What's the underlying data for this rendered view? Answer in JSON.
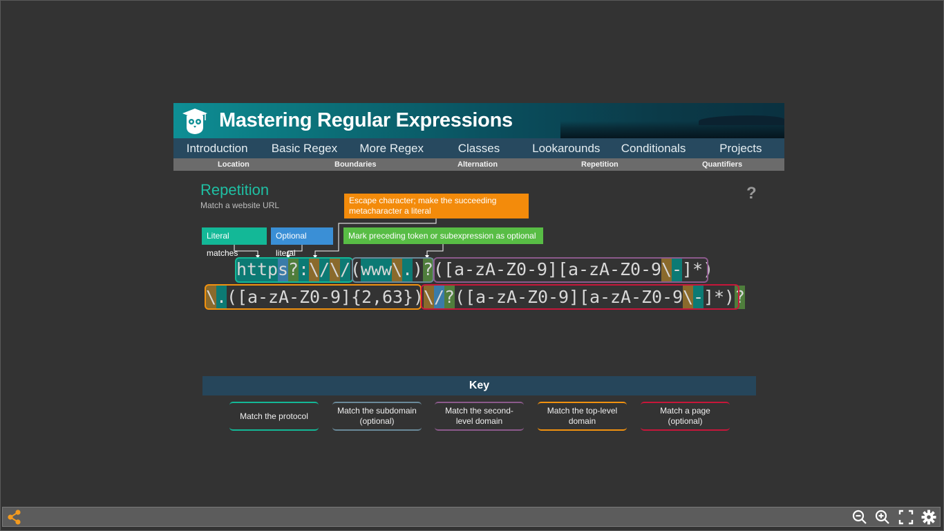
{
  "banner": {
    "title": "Mastering Regular Expressions",
    "logo_icon": "graduation-owl-icon"
  },
  "nav": {
    "items": [
      "Introduction",
      "Basic Regex",
      "More Regex",
      "Classes",
      "Lookarounds",
      "Conditionals",
      "Projects"
    ],
    "subitems": [
      "Location",
      "Boundaries",
      "Alternation",
      "Repetition",
      "Quantifiers"
    ]
  },
  "page": {
    "heading": "Repetition",
    "subheading": "Match a website URL",
    "help": "?"
  },
  "callouts": {
    "literal": "Literal matches",
    "optional": "Optional literal",
    "escape": "Escape character; make the succeeding metacharacter a literal",
    "mark": "Mark preceding token or subexpression as optional"
  },
  "regex": {
    "line1": [
      {
        "t": "h",
        "k": "lit"
      },
      {
        "t": "t",
        "k": "lit"
      },
      {
        "t": "t",
        "k": "lit"
      },
      {
        "t": "p",
        "k": "lit"
      },
      {
        "t": "s",
        "k": "opt"
      },
      {
        "t": "?",
        "k": "q"
      },
      {
        "t": ":",
        "k": "lit"
      },
      {
        "t": "\\",
        "k": "esc"
      },
      {
        "t": "/",
        "k": "lit"
      },
      {
        "t": "\\",
        "k": "esc"
      },
      {
        "t": "/",
        "k": "lit"
      },
      {
        "t": "(",
        "k": ""
      },
      {
        "t": "w",
        "k": "lit"
      },
      {
        "t": "w",
        "k": "lit"
      },
      {
        "t": "w",
        "k": "lit"
      },
      {
        "t": "\\",
        "k": "esc"
      },
      {
        "t": ".",
        "k": "lit"
      },
      {
        "t": ")",
        "k": ""
      },
      {
        "t": "?",
        "k": "q"
      },
      {
        "t": "(",
        "k": ""
      },
      {
        "t": "[",
        "k": ""
      },
      {
        "t": "a",
        "k": ""
      },
      {
        "t": "-",
        "k": ""
      },
      {
        "t": "z",
        "k": ""
      },
      {
        "t": "A",
        "k": ""
      },
      {
        "t": "-",
        "k": ""
      },
      {
        "t": "Z",
        "k": ""
      },
      {
        "t": "0",
        "k": ""
      },
      {
        "t": "-",
        "k": ""
      },
      {
        "t": "9",
        "k": ""
      },
      {
        "t": "]",
        "k": ""
      },
      {
        "t": "[",
        "k": ""
      },
      {
        "t": "a",
        "k": ""
      },
      {
        "t": "-",
        "k": ""
      },
      {
        "t": "z",
        "k": ""
      },
      {
        "t": "A",
        "k": ""
      },
      {
        "t": "-",
        "k": ""
      },
      {
        "t": "Z",
        "k": ""
      },
      {
        "t": "0",
        "k": ""
      },
      {
        "t": "-",
        "k": ""
      },
      {
        "t": "9",
        "k": ""
      },
      {
        "t": "\\",
        "k": "esc"
      },
      {
        "t": "-",
        "k": "lit"
      },
      {
        "t": "]",
        "k": ""
      },
      {
        "t": "*",
        "k": ""
      },
      {
        "t": ")",
        "k": ""
      }
    ],
    "line2": [
      {
        "t": "\\",
        "k": "esc"
      },
      {
        "t": ".",
        "k": "lit"
      },
      {
        "t": "(",
        "k": ""
      },
      {
        "t": "[",
        "k": ""
      },
      {
        "t": "a",
        "k": ""
      },
      {
        "t": "-",
        "k": ""
      },
      {
        "t": "z",
        "k": ""
      },
      {
        "t": "A",
        "k": ""
      },
      {
        "t": "-",
        "k": ""
      },
      {
        "t": "Z",
        "k": ""
      },
      {
        "t": "0",
        "k": ""
      },
      {
        "t": "-",
        "k": ""
      },
      {
        "t": "9",
        "k": ""
      },
      {
        "t": "]",
        "k": ""
      },
      {
        "t": "{",
        "k": ""
      },
      {
        "t": "2",
        "k": ""
      },
      {
        "t": ",",
        "k": ""
      },
      {
        "t": "6",
        "k": ""
      },
      {
        "t": "3",
        "k": ""
      },
      {
        "t": "}",
        "k": ""
      },
      {
        "t": ")",
        "k": ""
      },
      {
        "t": "\\",
        "k": "esc"
      },
      {
        "t": "/",
        "k": "opt"
      },
      {
        "t": "?",
        "k": "q"
      },
      {
        "t": "(",
        "k": ""
      },
      {
        "t": "[",
        "k": ""
      },
      {
        "t": "a",
        "k": ""
      },
      {
        "t": "-",
        "k": ""
      },
      {
        "t": "z",
        "k": ""
      },
      {
        "t": "A",
        "k": ""
      },
      {
        "t": "-",
        "k": ""
      },
      {
        "t": "Z",
        "k": ""
      },
      {
        "t": "0",
        "k": ""
      },
      {
        "t": "-",
        "k": ""
      },
      {
        "t": "9",
        "k": ""
      },
      {
        "t": "]",
        "k": ""
      },
      {
        "t": "[",
        "k": ""
      },
      {
        "t": "a",
        "k": ""
      },
      {
        "t": "-",
        "k": ""
      },
      {
        "t": "z",
        "k": ""
      },
      {
        "t": "A",
        "k": ""
      },
      {
        "t": "-",
        "k": ""
      },
      {
        "t": "Z",
        "k": ""
      },
      {
        "t": "0",
        "k": ""
      },
      {
        "t": "-",
        "k": ""
      },
      {
        "t": "9",
        "k": ""
      },
      {
        "t": "\\",
        "k": "esc"
      },
      {
        "t": "-",
        "k": "lit"
      },
      {
        "t": "]",
        "k": ""
      },
      {
        "t": "*",
        "k": ""
      },
      {
        "t": ")",
        "k": ""
      },
      {
        "t": "?",
        "k": "q"
      }
    ]
  },
  "key": {
    "title": "Key",
    "items": [
      {
        "label": "Match the protocol",
        "color": "#13b897"
      },
      {
        "label": "Match the subdomain (optional)",
        "color": "#6a8a9a"
      },
      {
        "label": "Match the second-level domain",
        "color": "#8c5a8c"
      },
      {
        "label": "Match the top-level domain",
        "color": "#f2920f"
      },
      {
        "label": "Match a page (optional)",
        "color": "#c8163a"
      }
    ]
  },
  "colors": {
    "accent_teal": "#1fbfa3",
    "toolbar_orange": "#f39a1f"
  },
  "toolbar": {
    "icons": [
      "share-icon",
      "zoom-out-icon",
      "zoom-in-icon",
      "fullscreen-icon",
      "settings-gear-icon"
    ]
  }
}
